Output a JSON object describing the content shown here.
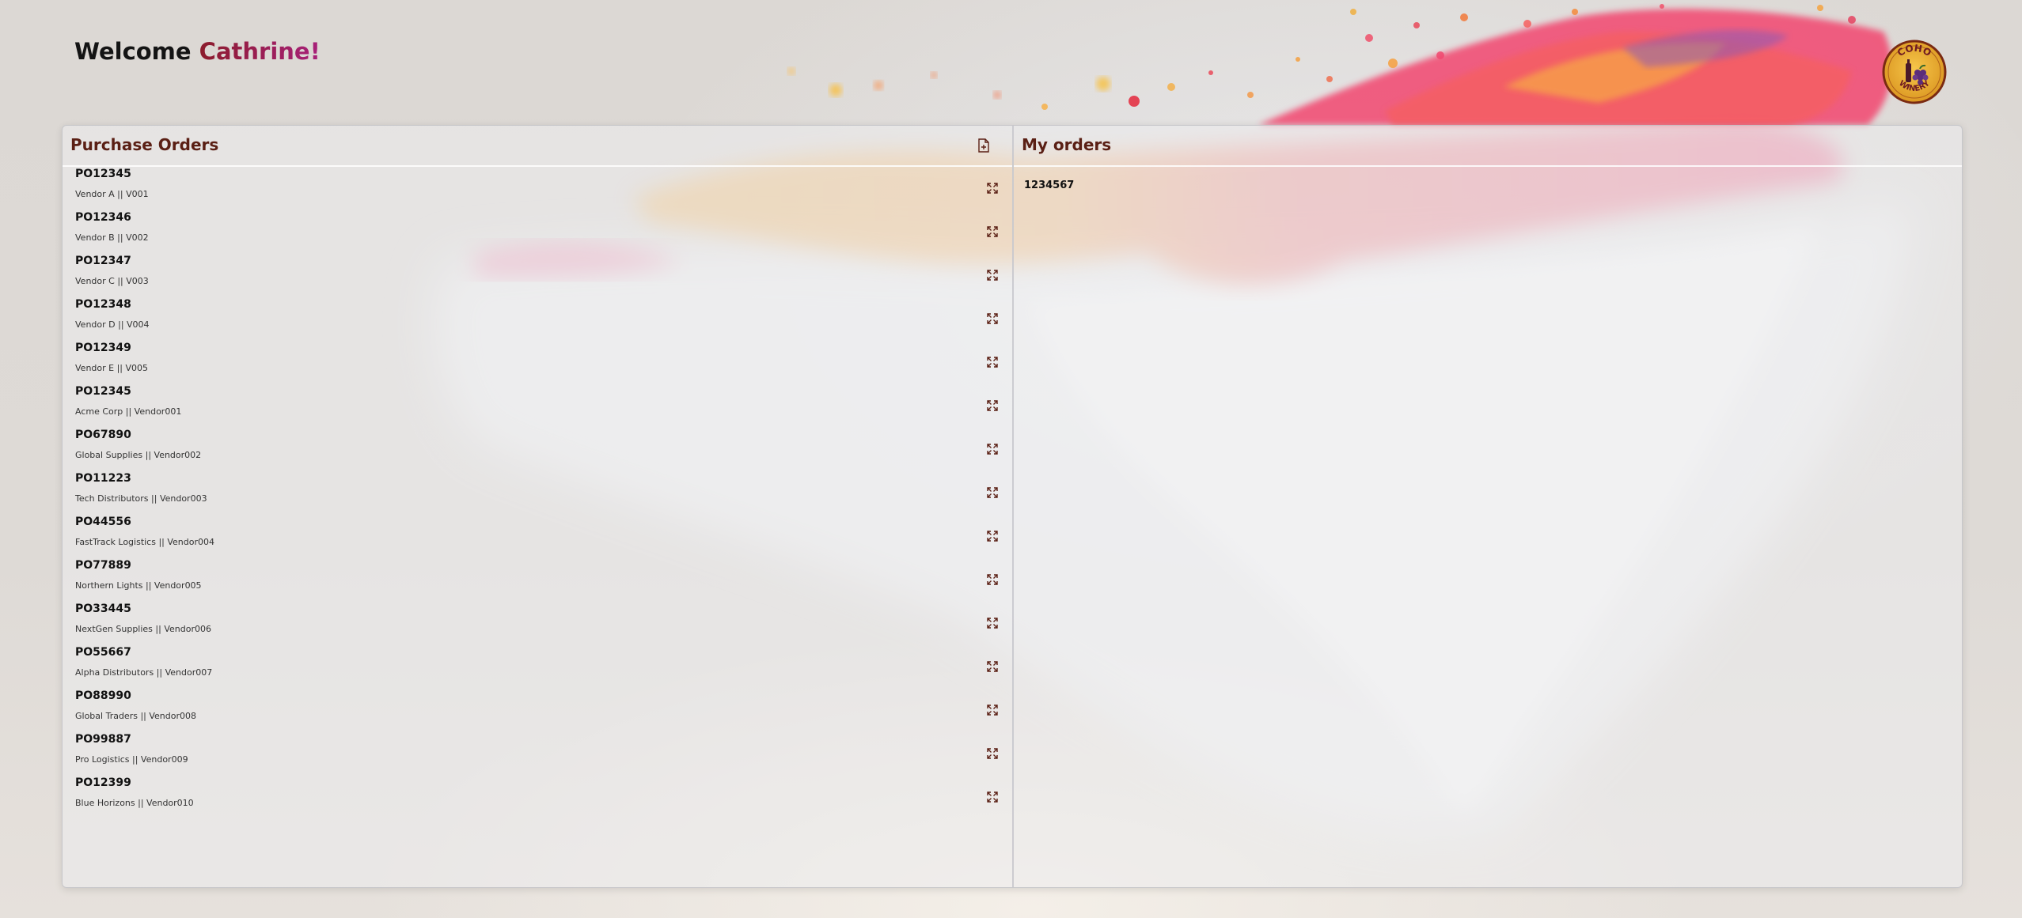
{
  "header": {
    "welcome_prefix": "Welcome ",
    "user_name": "Cathrine!"
  },
  "logo": {
    "line1": "COHO",
    "line2": "WINERY"
  },
  "purchase_orders": {
    "title": "Purchase Orders",
    "export_icon": "file-plus-icon",
    "expand_icon": "expand-icon",
    "items": [
      {
        "id": "PO12345",
        "vendor": "Vendor A || V001"
      },
      {
        "id": "PO12346",
        "vendor": "Vendor B || V002"
      },
      {
        "id": "PO12347",
        "vendor": "Vendor C || V003"
      },
      {
        "id": "PO12348",
        "vendor": "Vendor D || V004"
      },
      {
        "id": "PO12349",
        "vendor": "Vendor E || V005"
      },
      {
        "id": "PO12345",
        "vendor": "Acme Corp || Vendor001"
      },
      {
        "id": "PO67890",
        "vendor": "Global Supplies || Vendor002"
      },
      {
        "id": "PO11223",
        "vendor": "Tech Distributors || Vendor003"
      },
      {
        "id": "PO44556",
        "vendor": "FastTrack Logistics || Vendor004"
      },
      {
        "id": "PO77889",
        "vendor": "Northern Lights || Vendor005"
      },
      {
        "id": "PO33445",
        "vendor": "NextGen Supplies || Vendor006"
      },
      {
        "id": "PO55667",
        "vendor": "Alpha Distributors || Vendor007"
      },
      {
        "id": "PO88990",
        "vendor": "Global Traders || Vendor008"
      },
      {
        "id": "PO99887",
        "vendor": "Pro Logistics || Vendor009"
      },
      {
        "id": "PO12399",
        "vendor": "Blue Horizons || Vendor010"
      }
    ]
  },
  "my_orders": {
    "title": "My orders",
    "items": [
      "1234567"
    ]
  },
  "colors": {
    "accent": "#5a1f14",
    "name_gradient_start": "#8c1c2c",
    "name_gradient_end": "#a8207a"
  }
}
